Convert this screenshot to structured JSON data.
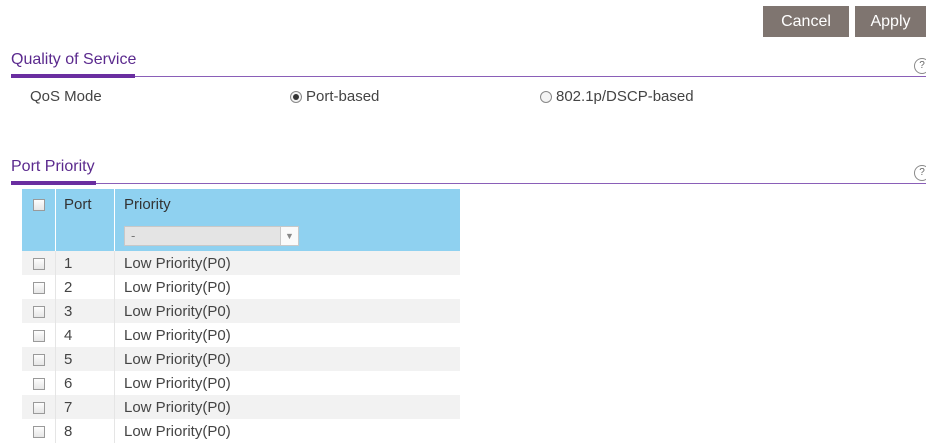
{
  "toolbar": {
    "cancel_label": "Cancel",
    "apply_label": "Apply"
  },
  "qos_section": {
    "title": "Quality of Service",
    "mode_label": "QoS Mode",
    "options": [
      {
        "label": "Port-based",
        "selected": true
      },
      {
        "label": "802.1p/DSCP-based",
        "selected": false
      }
    ]
  },
  "port_priority": {
    "title": "Port Priority",
    "columns": {
      "port": "Port",
      "priority": "Priority"
    },
    "bulk_select_value": "-",
    "rows": [
      {
        "port": "1",
        "priority": "Low Priority(P0)"
      },
      {
        "port": "2",
        "priority": "Low Priority(P0)"
      },
      {
        "port": "3",
        "priority": "Low Priority(P0)"
      },
      {
        "port": "4",
        "priority": "Low Priority(P0)"
      },
      {
        "port": "5",
        "priority": "Low Priority(P0)"
      },
      {
        "port": "6",
        "priority": "Low Priority(P0)"
      },
      {
        "port": "7",
        "priority": "Low Priority(P0)"
      },
      {
        "port": "8",
        "priority": "Low Priority(P0)"
      }
    ]
  },
  "colors": {
    "accent": "#6a2ea0",
    "button": "#7f7570",
    "table_header": "#8fd1f0"
  }
}
